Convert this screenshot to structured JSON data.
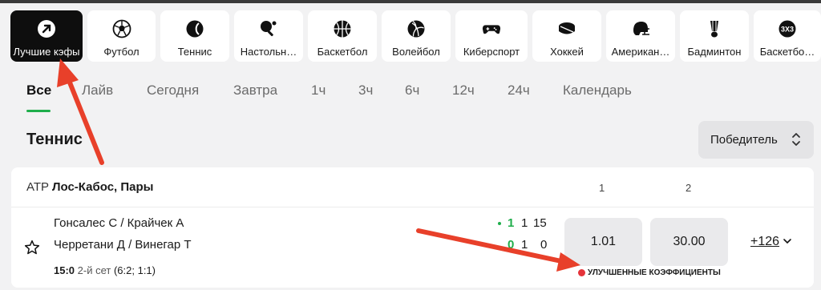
{
  "sports_nav": [
    {
      "label": "Лучшие кэфы",
      "icon": "arrow-up-right-icon",
      "active": true
    },
    {
      "label": "Футбол",
      "icon": "football-icon"
    },
    {
      "label": "Теннис",
      "icon": "tennis-icon"
    },
    {
      "label": "Настольн…",
      "icon": "table-tennis-icon"
    },
    {
      "label": "Баскетбол",
      "icon": "basketball-icon"
    },
    {
      "label": "Волейбол",
      "icon": "volleyball-icon"
    },
    {
      "label": "Киберспорт",
      "icon": "gamepad-icon"
    },
    {
      "label": "Хоккей",
      "icon": "hockey-puck-icon"
    },
    {
      "label": "Американ…",
      "icon": "american-football-helmet-icon"
    },
    {
      "label": "Бадминтон",
      "icon": "shuttlecock-icon"
    },
    {
      "label": "Баскетбо…",
      "icon": "3x3-basketball-icon"
    }
  ],
  "tabs": [
    "Все",
    "Лайв",
    "Сегодня",
    "Завтра",
    "1ч",
    "3ч",
    "6ч",
    "12ч",
    "24ч",
    "Календарь"
  ],
  "section_title": "Теннис",
  "market_select": {
    "label": "Победитель"
  },
  "event": {
    "league_category": "ATP",
    "league_name": "Лос-Кабос, Пары",
    "col_1": "1",
    "col_2": "2",
    "team1": "Гонсалес С / Крайчек А",
    "team2": "Черретани Д / Винегар Т",
    "team1_sets": "1",
    "team1_games": "1",
    "team1_points": "15",
    "team2_sets": "0",
    "team2_games": "1",
    "team2_points": "0",
    "score": "15:0",
    "set_label": "2-й сет",
    "set_scores": "(6:2; 1:1)",
    "odd_1": "1.01",
    "odd_2": "30.00",
    "more_markets": "+126",
    "boost_label": "УЛУЧШЕННЫЕ КОЭФФИЦИЕНТЫ"
  },
  "colors": {
    "accent": "#1fae4b",
    "annotation_arrow": "#e8402a",
    "active_tile": "#0e0e0e"
  }
}
